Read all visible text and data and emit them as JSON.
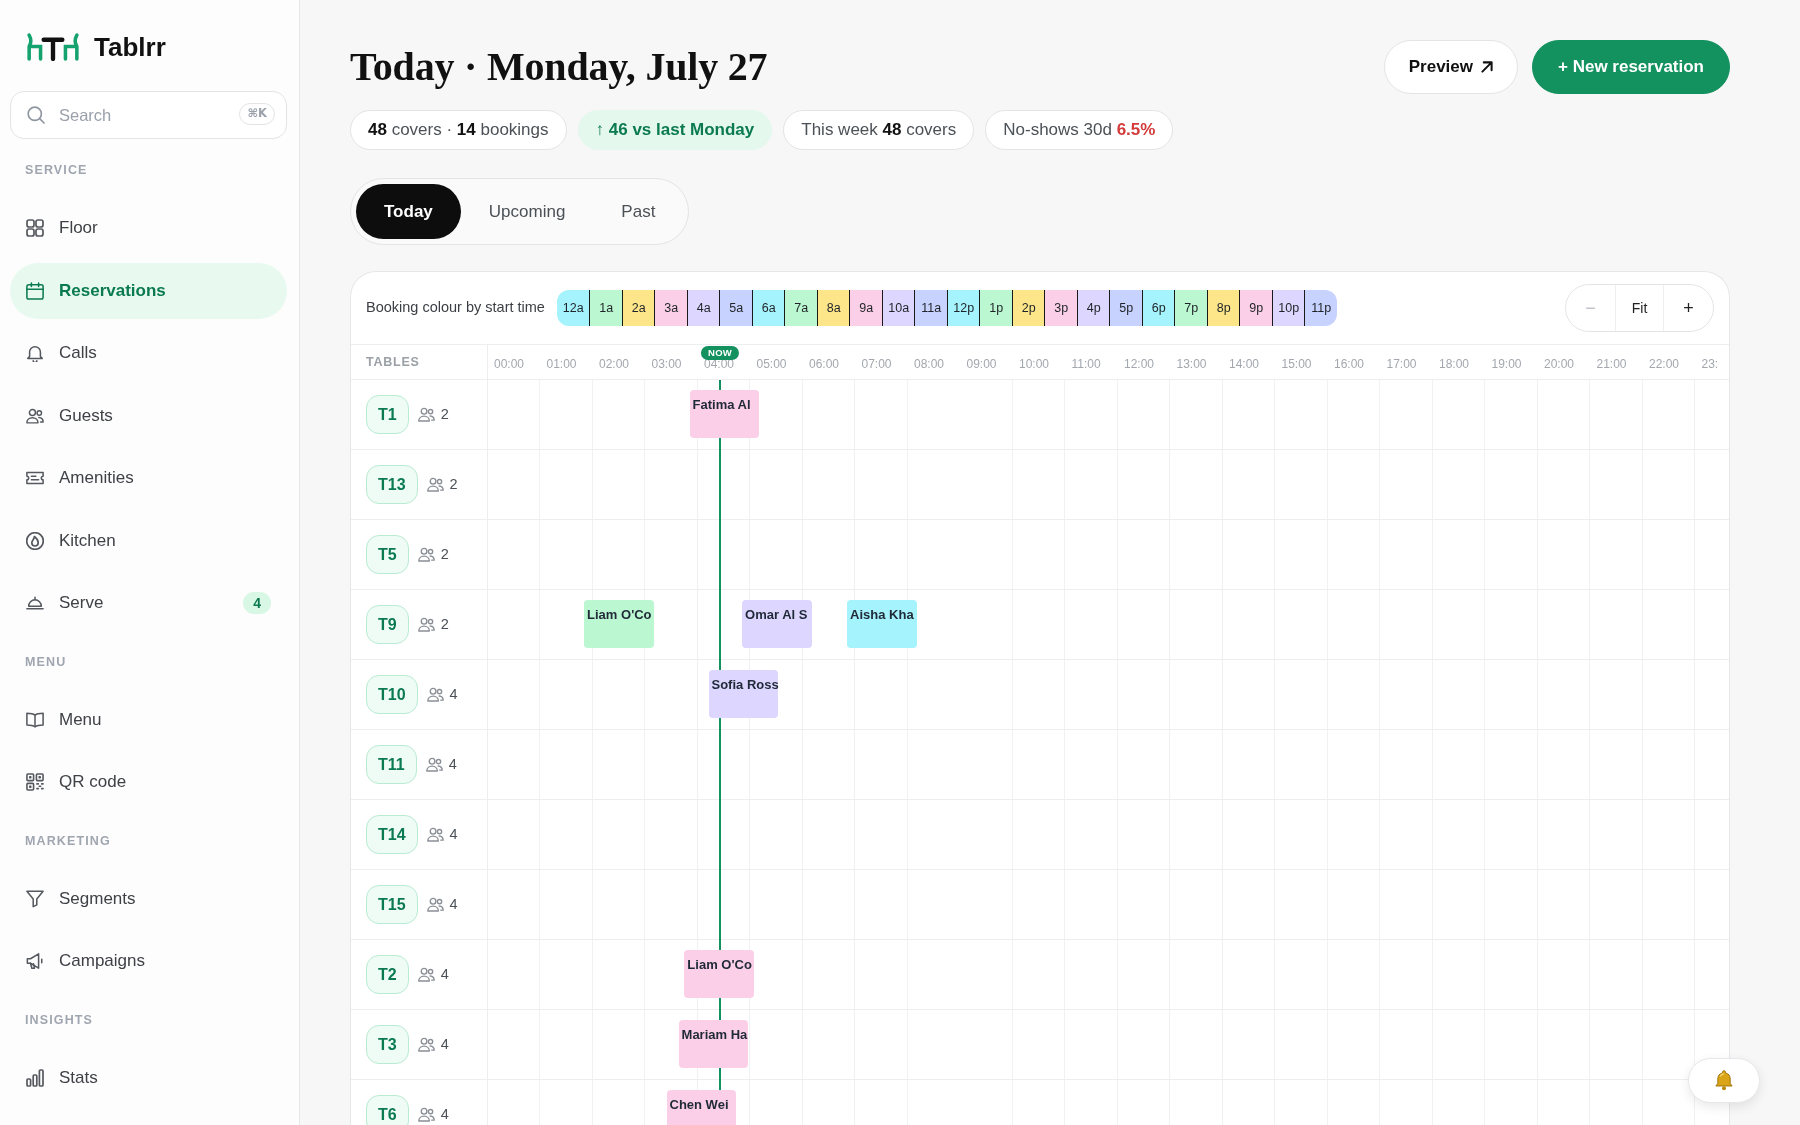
{
  "sidebar": {
    "brand": "Tablrr",
    "search": {
      "placeholder": "Search",
      "shortcut": "⌘K"
    },
    "sections": [
      {
        "title": "SERVICE",
        "items": [
          {
            "label": "Floor",
            "selected": false
          },
          {
            "label": "Reservations",
            "selected": true
          },
          {
            "label": "Calls",
            "selected": false
          },
          {
            "label": "Guests",
            "selected": false
          },
          {
            "label": "Amenities",
            "selected": false
          },
          {
            "label": "Kitchen",
            "selected": false
          },
          {
            "label": "Serve",
            "selected": false,
            "badge": "4"
          }
        ]
      },
      {
        "title": "MENU",
        "items": [
          {
            "label": "Menu",
            "selected": false
          },
          {
            "label": "QR code",
            "selected": false
          }
        ]
      },
      {
        "title": "MARKETING",
        "items": [
          {
            "label": "Segments",
            "selected": false
          },
          {
            "label": "Campaigns",
            "selected": false
          }
        ]
      },
      {
        "title": "INSIGHTS",
        "items": [
          {
            "label": "Stats",
            "selected": false
          }
        ]
      }
    ]
  },
  "header": {
    "title": "Today · Monday, July 27",
    "buttons": [
      {
        "kind": "external",
        "label": "Preview"
      },
      {
        "kind": "primary",
        "label": "+ New reservation"
      }
    ]
  },
  "stats": [
    {
      "kind": "counts",
      "text": "**48** covers · **14** bookings"
    },
    {
      "kind": "trend",
      "text": "↑ 46 vs last Monday"
    },
    {
      "kind": "counts",
      "text": "This week **48** covers"
    },
    {
      "kind": "alert",
      "label": "No-shows 30d",
      "value": "6.5%"
    }
  ],
  "tabs": [
    {
      "label": "Today",
      "selected": true
    },
    {
      "label": "Upcoming",
      "selected": false
    },
    {
      "label": "Past",
      "selected": false
    }
  ],
  "timeline": {
    "legend": {
      "label": "Booking colour by start time",
      "slots": [
        {
          "label": "12a",
          "color": "#a5f3fc"
        },
        {
          "label": "1a",
          "color": "#bbf7d0"
        },
        {
          "label": "2a",
          "color": "#fde68a"
        },
        {
          "label": "3a",
          "color": "#fbcfe8"
        },
        {
          "label": "4a",
          "color": "#ddd6fe"
        },
        {
          "label": "5a",
          "color": "#c7d2fe"
        },
        {
          "label": "6a",
          "color": "#a5f3fc"
        },
        {
          "label": "7a",
          "color": "#bbf7d0"
        },
        {
          "label": "8a",
          "color": "#fde68a"
        },
        {
          "label": "9a",
          "color": "#fbcfe8"
        },
        {
          "label": "10a",
          "color": "#ddd6fe"
        },
        {
          "label": "11a",
          "color": "#c7d2fe"
        },
        {
          "label": "12p",
          "color": "#a5f3fc"
        },
        {
          "label": "1p",
          "color": "#bbf7d0"
        },
        {
          "label": "2p",
          "color": "#fde68a"
        },
        {
          "label": "3p",
          "color": "#fbcfe8"
        },
        {
          "label": "4p",
          "color": "#ddd6fe"
        },
        {
          "label": "5p",
          "color": "#c7d2fe"
        },
        {
          "label": "6p",
          "color": "#a5f3fc"
        },
        {
          "label": "7p",
          "color": "#bbf7d0"
        },
        {
          "label": "8p",
          "color": "#fde68a"
        },
        {
          "label": "9p",
          "color": "#fbcfe8"
        },
        {
          "label": "10p",
          "color": "#ddd6fe"
        },
        {
          "label": "11p",
          "color": "#c7d2fe"
        }
      ]
    },
    "zoom_controls": [
      {
        "label": "−",
        "disabled": true
      },
      {
        "label": "Fit",
        "disabled": false
      },
      {
        "label": "+",
        "disabled": false
      }
    ],
    "tables_heading": "TABLES",
    "hours": [
      "00:00",
      "01:00",
      "02:00",
      "03:00",
      "04:00",
      "05:00",
      "06:00",
      "07:00",
      "08:00",
      "09:00",
      "10:00",
      "11:00",
      "12:00",
      "13:00",
      "14:00",
      "15:00",
      "16:00",
      "17:00",
      "18:00",
      "19:00",
      "20:00",
      "21:00",
      "22:00",
      "23:"
    ],
    "now_marker": {
      "label": "NOW"
    },
    "rows": [
      {
        "table": "T1",
        "seats": "2",
        "bookings": [
          {
            "guest": "Fatima Al",
            "color": "#fbcfe8"
          }
        ]
      },
      {
        "table": "T13",
        "seats": "2",
        "bookings": []
      },
      {
        "table": "T5",
        "seats": "2",
        "bookings": []
      },
      {
        "table": "T9",
        "seats": "2",
        "bookings": [
          {
            "guest": "Liam O'Co",
            "color": "#bbf7d0"
          },
          {
            "guest": "Omar Al S",
            "color": "#ddd6fe"
          },
          {
            "guest": "Aisha Kha",
            "color": "#a5f3fc"
          }
        ]
      },
      {
        "table": "T10",
        "seats": "4",
        "bookings": [
          {
            "guest": "Sofia Ross",
            "color": "#ddd6fe"
          }
        ]
      },
      {
        "table": "T11",
        "seats": "4",
        "bookings": []
      },
      {
        "table": "T14",
        "seats": "4",
        "bookings": []
      },
      {
        "table": "T15",
        "seats": "4",
        "bookings": []
      },
      {
        "table": "T2",
        "seats": "4",
        "bookings": [
          {
            "guest": "Liam O'Co",
            "color": "#fbcfe8"
          }
        ]
      },
      {
        "table": "T3",
        "seats": "4",
        "bookings": [
          {
            "guest": "Mariam Ha",
            "color": "#fbcfe8"
          }
        ]
      },
      {
        "table": "T6",
        "seats": "4",
        "bookings": [
          {
            "guest": "Chen Wei",
            "color": "#fbcfe8"
          }
        ]
      }
    ]
  }
}
